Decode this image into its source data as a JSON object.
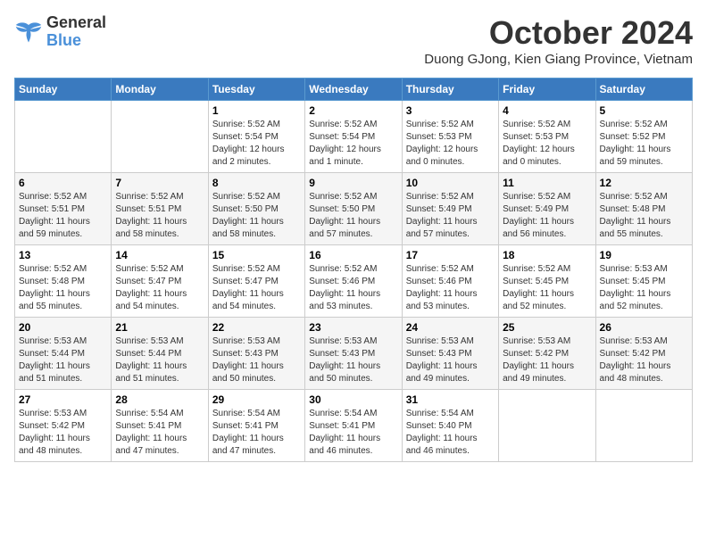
{
  "logo": {
    "text_general": "General",
    "text_blue": "Blue"
  },
  "header": {
    "month_title": "October 2024",
    "subtitle": "Duong GJong, Kien Giang Province, Vietnam"
  },
  "days_of_week": [
    "Sunday",
    "Monday",
    "Tuesday",
    "Wednesday",
    "Thursday",
    "Friday",
    "Saturday"
  ],
  "weeks": [
    [
      {
        "day": "",
        "info": ""
      },
      {
        "day": "",
        "info": ""
      },
      {
        "day": "1",
        "info": "Sunrise: 5:52 AM\nSunset: 5:54 PM\nDaylight: 12 hours\nand 2 minutes."
      },
      {
        "day": "2",
        "info": "Sunrise: 5:52 AM\nSunset: 5:54 PM\nDaylight: 12 hours\nand 1 minute."
      },
      {
        "day": "3",
        "info": "Sunrise: 5:52 AM\nSunset: 5:53 PM\nDaylight: 12 hours\nand 0 minutes."
      },
      {
        "day": "4",
        "info": "Sunrise: 5:52 AM\nSunset: 5:53 PM\nDaylight: 12 hours\nand 0 minutes."
      },
      {
        "day": "5",
        "info": "Sunrise: 5:52 AM\nSunset: 5:52 PM\nDaylight: 11 hours\nand 59 minutes."
      }
    ],
    [
      {
        "day": "6",
        "info": "Sunrise: 5:52 AM\nSunset: 5:51 PM\nDaylight: 11 hours\nand 59 minutes."
      },
      {
        "day": "7",
        "info": "Sunrise: 5:52 AM\nSunset: 5:51 PM\nDaylight: 11 hours\nand 58 minutes."
      },
      {
        "day": "8",
        "info": "Sunrise: 5:52 AM\nSunset: 5:50 PM\nDaylight: 11 hours\nand 58 minutes."
      },
      {
        "day": "9",
        "info": "Sunrise: 5:52 AM\nSunset: 5:50 PM\nDaylight: 11 hours\nand 57 minutes."
      },
      {
        "day": "10",
        "info": "Sunrise: 5:52 AM\nSunset: 5:49 PM\nDaylight: 11 hours\nand 57 minutes."
      },
      {
        "day": "11",
        "info": "Sunrise: 5:52 AM\nSunset: 5:49 PM\nDaylight: 11 hours\nand 56 minutes."
      },
      {
        "day": "12",
        "info": "Sunrise: 5:52 AM\nSunset: 5:48 PM\nDaylight: 11 hours\nand 55 minutes."
      }
    ],
    [
      {
        "day": "13",
        "info": "Sunrise: 5:52 AM\nSunset: 5:48 PM\nDaylight: 11 hours\nand 55 minutes."
      },
      {
        "day": "14",
        "info": "Sunrise: 5:52 AM\nSunset: 5:47 PM\nDaylight: 11 hours\nand 54 minutes."
      },
      {
        "day": "15",
        "info": "Sunrise: 5:52 AM\nSunset: 5:47 PM\nDaylight: 11 hours\nand 54 minutes."
      },
      {
        "day": "16",
        "info": "Sunrise: 5:52 AM\nSunset: 5:46 PM\nDaylight: 11 hours\nand 53 minutes."
      },
      {
        "day": "17",
        "info": "Sunrise: 5:52 AM\nSunset: 5:46 PM\nDaylight: 11 hours\nand 53 minutes."
      },
      {
        "day": "18",
        "info": "Sunrise: 5:52 AM\nSunset: 5:45 PM\nDaylight: 11 hours\nand 52 minutes."
      },
      {
        "day": "19",
        "info": "Sunrise: 5:53 AM\nSunset: 5:45 PM\nDaylight: 11 hours\nand 52 minutes."
      }
    ],
    [
      {
        "day": "20",
        "info": "Sunrise: 5:53 AM\nSunset: 5:44 PM\nDaylight: 11 hours\nand 51 minutes."
      },
      {
        "day": "21",
        "info": "Sunrise: 5:53 AM\nSunset: 5:44 PM\nDaylight: 11 hours\nand 51 minutes."
      },
      {
        "day": "22",
        "info": "Sunrise: 5:53 AM\nSunset: 5:43 PM\nDaylight: 11 hours\nand 50 minutes."
      },
      {
        "day": "23",
        "info": "Sunrise: 5:53 AM\nSunset: 5:43 PM\nDaylight: 11 hours\nand 50 minutes."
      },
      {
        "day": "24",
        "info": "Sunrise: 5:53 AM\nSunset: 5:43 PM\nDaylight: 11 hours\nand 49 minutes."
      },
      {
        "day": "25",
        "info": "Sunrise: 5:53 AM\nSunset: 5:42 PM\nDaylight: 11 hours\nand 49 minutes."
      },
      {
        "day": "26",
        "info": "Sunrise: 5:53 AM\nSunset: 5:42 PM\nDaylight: 11 hours\nand 48 minutes."
      }
    ],
    [
      {
        "day": "27",
        "info": "Sunrise: 5:53 AM\nSunset: 5:42 PM\nDaylight: 11 hours\nand 48 minutes."
      },
      {
        "day": "28",
        "info": "Sunrise: 5:54 AM\nSunset: 5:41 PM\nDaylight: 11 hours\nand 47 minutes."
      },
      {
        "day": "29",
        "info": "Sunrise: 5:54 AM\nSunset: 5:41 PM\nDaylight: 11 hours\nand 47 minutes."
      },
      {
        "day": "30",
        "info": "Sunrise: 5:54 AM\nSunset: 5:41 PM\nDaylight: 11 hours\nand 46 minutes."
      },
      {
        "day": "31",
        "info": "Sunrise: 5:54 AM\nSunset: 5:40 PM\nDaylight: 11 hours\nand 46 minutes."
      },
      {
        "day": "",
        "info": ""
      },
      {
        "day": "",
        "info": ""
      }
    ]
  ]
}
